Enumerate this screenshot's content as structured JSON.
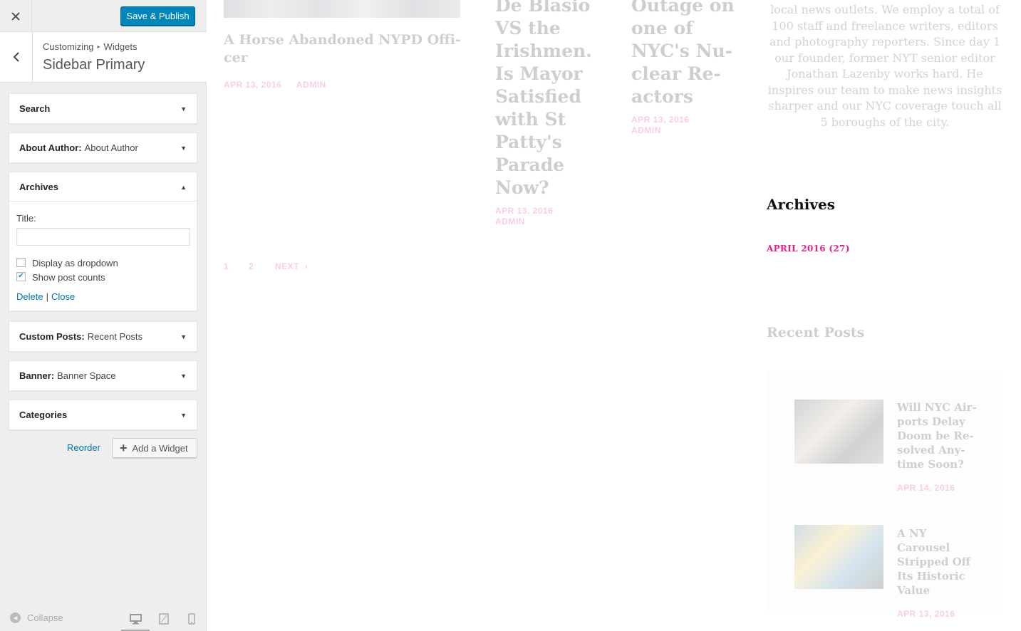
{
  "header": {
    "publish_label": "Save & Publish"
  },
  "section": {
    "crumb_1": "Customizing",
    "crumb_sep": "▸",
    "crumb_2": "Widgets",
    "title": "Sidebar Primary"
  },
  "widgets": [
    {
      "name": "Search",
      "subtitle": ""
    },
    {
      "name": "About Author:",
      "subtitle": "About Author"
    },
    {
      "name": "Archives",
      "subtitle": ""
    },
    {
      "name": "Custom Posts:",
      "subtitle": "Recent Posts"
    },
    {
      "name": "Banner:",
      "subtitle": "Banner Space"
    },
    {
      "name": "Categories",
      "subtitle": ""
    }
  ],
  "archives_form": {
    "title_label": "Title:",
    "title_value": "",
    "dropdown_label": "Display as dropdown",
    "dropdown_checked": false,
    "counts_label": "Show post counts",
    "counts_checked": true,
    "delete_label": "Delete",
    "separator": "|",
    "close_label": "Close"
  },
  "actions": {
    "reorder_label": "Reorder",
    "add_widget_label": "Add a Widget"
  },
  "footer": {
    "collapse_label": "Collapse"
  },
  "preview": {
    "post1": {
      "title": "A Horse Abandoned NYPD Offi-cer",
      "date": "APR 13, 2016",
      "author": "ADMIN"
    },
    "post2": {
      "title": "De Blasio VS the Irishmen. Is Mayor Satisfied with St Patty's Parade Now?",
      "date": "APR 13, 2016",
      "author": "ADMIN"
    },
    "post3": {
      "title": "Outage on one of NYC's Nu-clear Re-actors",
      "date": "APR 13, 2016",
      "author": "ADMIN"
    },
    "pagination": {
      "page1": "1",
      "page2": "2",
      "next": "NEXT"
    },
    "about_text": "local news outlets. We employ a total of 100 staff and freelance writers, editors and photography reporters. Since day 1 our founder, former NYT senior editor Jonathan Lazenby works hard. He inspires our team to make news insights sharper and our NYC coverage touch all 5 boroughs of the city.",
    "archives_title": "Archives",
    "archives_link": "APRIL 2016 (27)",
    "recent_title": "Recent Posts",
    "recent": [
      {
        "title": "Will NYC Air-ports Delay Doom be Re-solved Any-time Soon?",
        "date": "APR 14, 2016"
      },
      {
        "title": "A NY Carousel Stripped Off Its Historic Value",
        "date": "APR 13, 2016"
      }
    ]
  },
  "colors": {
    "primary_button": "#0085ba",
    "link": "#0073aa",
    "accent_pink": "#e91e8c"
  }
}
